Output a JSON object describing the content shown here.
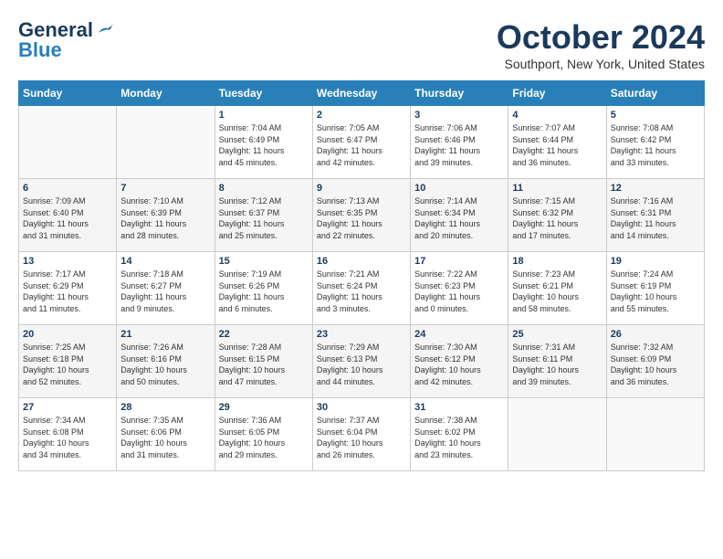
{
  "header": {
    "logo_line1": "General",
    "logo_line2": "Blue",
    "month": "October 2024",
    "location": "Southport, New York, United States"
  },
  "days_of_week": [
    "Sunday",
    "Monday",
    "Tuesday",
    "Wednesday",
    "Thursday",
    "Friday",
    "Saturday"
  ],
  "weeks": [
    [
      {
        "day": "",
        "content": ""
      },
      {
        "day": "",
        "content": ""
      },
      {
        "day": "1",
        "content": "Sunrise: 7:04 AM\nSunset: 6:49 PM\nDaylight: 11 hours\nand 45 minutes."
      },
      {
        "day": "2",
        "content": "Sunrise: 7:05 AM\nSunset: 6:47 PM\nDaylight: 11 hours\nand 42 minutes."
      },
      {
        "day": "3",
        "content": "Sunrise: 7:06 AM\nSunset: 6:46 PM\nDaylight: 11 hours\nand 39 minutes."
      },
      {
        "day": "4",
        "content": "Sunrise: 7:07 AM\nSunset: 6:44 PM\nDaylight: 11 hours\nand 36 minutes."
      },
      {
        "day": "5",
        "content": "Sunrise: 7:08 AM\nSunset: 6:42 PM\nDaylight: 11 hours\nand 33 minutes."
      }
    ],
    [
      {
        "day": "6",
        "content": "Sunrise: 7:09 AM\nSunset: 6:40 PM\nDaylight: 11 hours\nand 31 minutes."
      },
      {
        "day": "7",
        "content": "Sunrise: 7:10 AM\nSunset: 6:39 PM\nDaylight: 11 hours\nand 28 minutes."
      },
      {
        "day": "8",
        "content": "Sunrise: 7:12 AM\nSunset: 6:37 PM\nDaylight: 11 hours\nand 25 minutes."
      },
      {
        "day": "9",
        "content": "Sunrise: 7:13 AM\nSunset: 6:35 PM\nDaylight: 11 hours\nand 22 minutes."
      },
      {
        "day": "10",
        "content": "Sunrise: 7:14 AM\nSunset: 6:34 PM\nDaylight: 11 hours\nand 20 minutes."
      },
      {
        "day": "11",
        "content": "Sunrise: 7:15 AM\nSunset: 6:32 PM\nDaylight: 11 hours\nand 17 minutes."
      },
      {
        "day": "12",
        "content": "Sunrise: 7:16 AM\nSunset: 6:31 PM\nDaylight: 11 hours\nand 14 minutes."
      }
    ],
    [
      {
        "day": "13",
        "content": "Sunrise: 7:17 AM\nSunset: 6:29 PM\nDaylight: 11 hours\nand 11 minutes."
      },
      {
        "day": "14",
        "content": "Sunrise: 7:18 AM\nSunset: 6:27 PM\nDaylight: 11 hours\nand 9 minutes."
      },
      {
        "day": "15",
        "content": "Sunrise: 7:19 AM\nSunset: 6:26 PM\nDaylight: 11 hours\nand 6 minutes."
      },
      {
        "day": "16",
        "content": "Sunrise: 7:21 AM\nSunset: 6:24 PM\nDaylight: 11 hours\nand 3 minutes."
      },
      {
        "day": "17",
        "content": "Sunrise: 7:22 AM\nSunset: 6:23 PM\nDaylight: 11 hours\nand 0 minutes."
      },
      {
        "day": "18",
        "content": "Sunrise: 7:23 AM\nSunset: 6:21 PM\nDaylight: 10 hours\nand 58 minutes."
      },
      {
        "day": "19",
        "content": "Sunrise: 7:24 AM\nSunset: 6:19 PM\nDaylight: 10 hours\nand 55 minutes."
      }
    ],
    [
      {
        "day": "20",
        "content": "Sunrise: 7:25 AM\nSunset: 6:18 PM\nDaylight: 10 hours\nand 52 minutes."
      },
      {
        "day": "21",
        "content": "Sunrise: 7:26 AM\nSunset: 6:16 PM\nDaylight: 10 hours\nand 50 minutes."
      },
      {
        "day": "22",
        "content": "Sunrise: 7:28 AM\nSunset: 6:15 PM\nDaylight: 10 hours\nand 47 minutes."
      },
      {
        "day": "23",
        "content": "Sunrise: 7:29 AM\nSunset: 6:13 PM\nDaylight: 10 hours\nand 44 minutes."
      },
      {
        "day": "24",
        "content": "Sunrise: 7:30 AM\nSunset: 6:12 PM\nDaylight: 10 hours\nand 42 minutes."
      },
      {
        "day": "25",
        "content": "Sunrise: 7:31 AM\nSunset: 6:11 PM\nDaylight: 10 hours\nand 39 minutes."
      },
      {
        "day": "26",
        "content": "Sunrise: 7:32 AM\nSunset: 6:09 PM\nDaylight: 10 hours\nand 36 minutes."
      }
    ],
    [
      {
        "day": "27",
        "content": "Sunrise: 7:34 AM\nSunset: 6:08 PM\nDaylight: 10 hours\nand 34 minutes."
      },
      {
        "day": "28",
        "content": "Sunrise: 7:35 AM\nSunset: 6:06 PM\nDaylight: 10 hours\nand 31 minutes."
      },
      {
        "day": "29",
        "content": "Sunrise: 7:36 AM\nSunset: 6:05 PM\nDaylight: 10 hours\nand 29 minutes."
      },
      {
        "day": "30",
        "content": "Sunrise: 7:37 AM\nSunset: 6:04 PM\nDaylight: 10 hours\nand 26 minutes."
      },
      {
        "day": "31",
        "content": "Sunrise: 7:38 AM\nSunset: 6:02 PM\nDaylight: 10 hours\nand 23 minutes."
      },
      {
        "day": "",
        "content": ""
      },
      {
        "day": "",
        "content": ""
      }
    ]
  ]
}
